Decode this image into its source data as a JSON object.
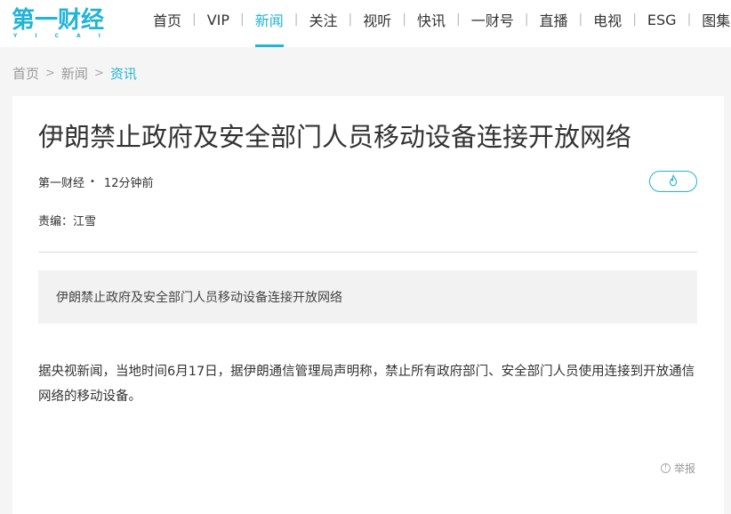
{
  "logo": {
    "text": "第一财经",
    "sub": "YICAI"
  },
  "nav": {
    "items": [
      {
        "label": "首页"
      },
      {
        "label": "VIP"
      },
      {
        "label": "新闻"
      },
      {
        "label": "关注"
      },
      {
        "label": "视听"
      },
      {
        "label": "快讯"
      },
      {
        "label": "一财号"
      },
      {
        "label": "直播"
      },
      {
        "label": "电视"
      },
      {
        "label": "ESG"
      },
      {
        "label": "图集"
      }
    ],
    "active": "新闻",
    "separator": "|"
  },
  "breadcrumb": {
    "home": "首页",
    "section": "新闻",
    "current": "资讯",
    "separator": ">"
  },
  "article": {
    "title": "伊朗禁止政府及安全部门人员移动设备连接开放网络",
    "source": "第一财经",
    "time": "12分钟前",
    "editor": "责编：江雪",
    "summary": "伊朗禁止政府及安全部门人员移动设备连接开放网络",
    "body": "据央视新闻，当地时间6月17日，据伊朗通信管理局声明称，禁止所有政府部门、安全部门人员使用连接到开放通信网络的移动设备。",
    "report_label": "举报"
  },
  "colors": {
    "accent": "#22b3d6",
    "background": "#f5f5f5"
  },
  "icons": {
    "hot": "flame-icon",
    "report": "info-circle-icon"
  }
}
